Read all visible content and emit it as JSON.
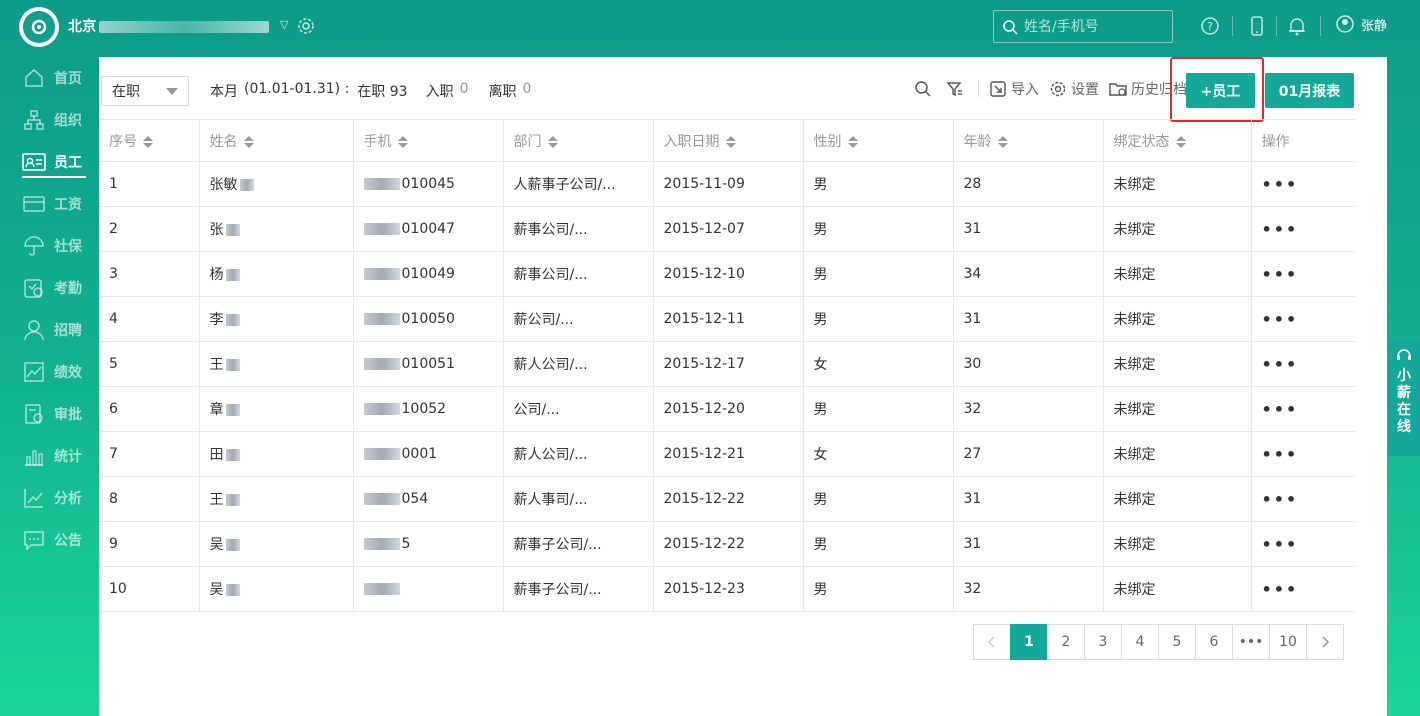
{
  "header": {
    "company_name": "北京",
    "search_placeholder": "姓名/手机号",
    "user_name": "张静"
  },
  "sidebar": {
    "items": [
      {
        "label": "首页",
        "icon": "home-icon"
      },
      {
        "label": "组织",
        "icon": "org-icon"
      },
      {
        "label": "员工",
        "icon": "employee-card-icon",
        "active": true
      },
      {
        "label": "工资",
        "icon": "wallet-icon"
      },
      {
        "label": "社保",
        "icon": "umbrella-icon"
      },
      {
        "label": "考勤",
        "icon": "attendance-icon"
      },
      {
        "label": "招聘",
        "icon": "person-icon"
      },
      {
        "label": "绩效",
        "icon": "trend-icon"
      },
      {
        "label": "审批",
        "icon": "approval-icon"
      },
      {
        "label": "统计",
        "icon": "bar-chart-icon"
      },
      {
        "label": "分析",
        "icon": "analysis-icon"
      },
      {
        "label": "公告",
        "icon": "message-icon"
      }
    ]
  },
  "toolbar": {
    "status_value": "在职",
    "summary_month": "本月",
    "summary_range": "(01.01-01.31) :",
    "summary_active_label": "在职 93",
    "summary_joined_label": "入职",
    "summary_joined_count": "0",
    "summary_left_label": "离职",
    "summary_left_count": "0",
    "import_label": "导入",
    "settings_label": "设置",
    "archive_label": "历史归档",
    "add_employee_label": "+员工",
    "report_label": "01月报表"
  },
  "table": {
    "headers": [
      "序号",
      "姓名",
      "手机",
      "部门",
      "入职日期",
      "性别",
      "年龄",
      "绑定状态",
      "操作"
    ],
    "rows": [
      {
        "no": "1",
        "name": "张敏",
        "phone": "010045",
        "dept": "人薪事子公司/...",
        "date": "2015-11-09",
        "gender": "男",
        "age": "28",
        "status": "未绑定"
      },
      {
        "no": "2",
        "name": "张",
        "phone": "010047",
        "dept": "薪事公司/...",
        "date": "2015-12-07",
        "gender": "男",
        "age": "31",
        "status": "未绑定"
      },
      {
        "no": "3",
        "name": "杨",
        "phone": "010049",
        "dept": "薪事公司/...",
        "date": "2015-12-10",
        "gender": "男",
        "age": "34",
        "status": "未绑定"
      },
      {
        "no": "4",
        "name": "李",
        "phone": "010050",
        "dept": "薪公司/...",
        "date": "2015-12-11",
        "gender": "男",
        "age": "31",
        "status": "未绑定"
      },
      {
        "no": "5",
        "name": "王",
        "phone": "010051",
        "dept": "薪人公司/...",
        "date": "2015-12-17",
        "gender": "女",
        "age": "30",
        "status": "未绑定"
      },
      {
        "no": "6",
        "name": "章",
        "phone": "10052",
        "dept": "公司/...",
        "date": "2015-12-20",
        "gender": "男",
        "age": "32",
        "status": "未绑定"
      },
      {
        "no": "7",
        "name": "田",
        "phone": "0001",
        "dept": "薪人公司/...",
        "date": "2015-12-21",
        "gender": "女",
        "age": "27",
        "status": "未绑定"
      },
      {
        "no": "8",
        "name": "王",
        "phone": "054",
        "dept": "薪人事司/...",
        "date": "2015-12-22",
        "gender": "男",
        "age": "31",
        "status": "未绑定"
      },
      {
        "no": "9",
        "name": "吴",
        "phone": "5",
        "dept": "薪事子公司/...",
        "date": "2015-12-22",
        "gender": "男",
        "age": "31",
        "status": "未绑定"
      },
      {
        "no": "10",
        "name": "吴",
        "phone": "",
        "dept": "薪事子公司/...",
        "date": "2015-12-23",
        "gender": "男",
        "age": "32",
        "status": "未绑定"
      }
    ],
    "more_label": "•••"
  },
  "pagination": {
    "pages": [
      "1",
      "2",
      "3",
      "4",
      "5",
      "6",
      "•••",
      "10"
    ],
    "current": "1"
  },
  "service": {
    "label": [
      "小",
      "薪",
      "在",
      "线"
    ]
  }
}
